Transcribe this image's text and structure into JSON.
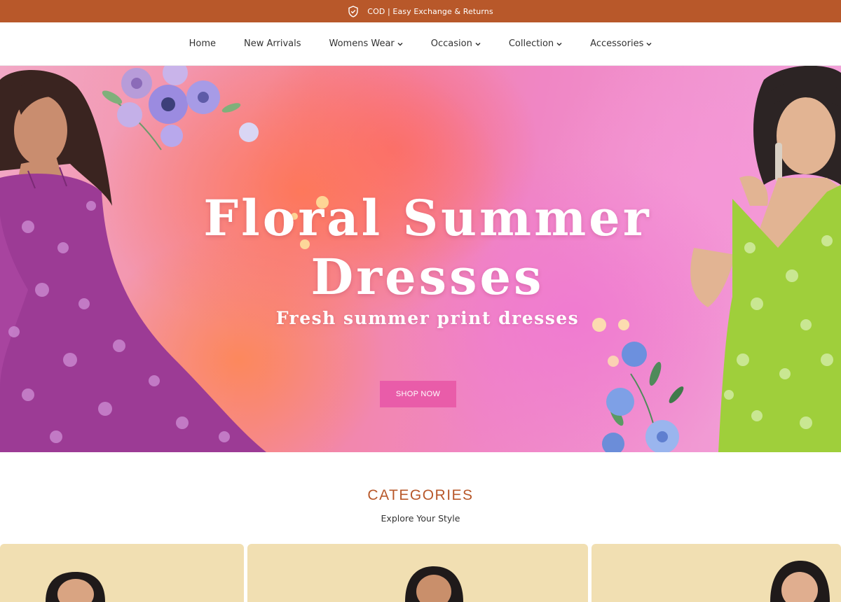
{
  "announcement": {
    "text": "COD | Easy Exchange & Returns",
    "icon": "shield-check-icon"
  },
  "nav": {
    "items": [
      {
        "label": "Home",
        "has_dropdown": false
      },
      {
        "label": "New Arrivals",
        "has_dropdown": false
      },
      {
        "label": "Womens Wear",
        "has_dropdown": true
      },
      {
        "label": "Occasion",
        "has_dropdown": true
      },
      {
        "label": "Collection",
        "has_dropdown": true
      },
      {
        "label": "Accessories",
        "has_dropdown": true
      }
    ]
  },
  "hero": {
    "title_line1": "Floral Summer",
    "title_line2": "Dresses",
    "subtitle": "Fresh summer print dresses",
    "button_label": "SHOP NOW"
  },
  "categories": {
    "title": "CATEGORIES",
    "subtitle": "Explore Your Style",
    "cards": 3
  },
  "colors": {
    "accent": "#b8582a",
    "button_pink": "#e95ca9",
    "card_bg": "#f1dfb2"
  }
}
